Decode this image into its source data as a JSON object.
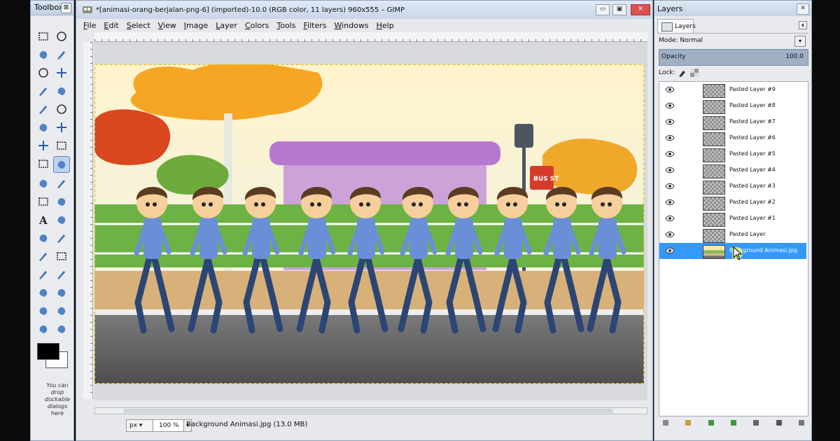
{
  "toolbox": {
    "title": "Toolbox",
    "close_glyph": "⊠",
    "tools": [
      "rect-select-icon",
      "ellipse-select-icon",
      "lasso-icon",
      "magic-wand-icon",
      "select-by-color-icon",
      "scissors-icon",
      "foreground-select-icon",
      "paths-icon",
      "color-picker-icon",
      "zoom-icon",
      "measure-icon",
      "move-icon",
      "align-icon",
      "crop-icon",
      "rotate-icon",
      "scale-icon",
      "shear-icon",
      "perspective-icon",
      "flip-icon",
      "cage-icon",
      "text-icon",
      "smudge-hand-icon",
      "bucket-fill-icon",
      "pencil-icon",
      "paintbrush-icon",
      "eraser-icon",
      "airbrush-icon",
      "ink-icon",
      "clone-icon",
      "heal-icon",
      "perspective-clone-icon",
      "blur-icon",
      "smudge-icon",
      "dodge-burn-icon"
    ],
    "drop_text": "You can drop dockable dialogs here",
    "fg_color": "#000000",
    "bg_color": "#ffffff"
  },
  "image_window": {
    "title": "*[animasi-orang-berjalan-png-6] (imported)-10.0 (RGB color, 11 layers) 960x555 – GIMP",
    "menus": [
      "File",
      "Edit",
      "Select",
      "View",
      "Image",
      "Layer",
      "Colors",
      "Tools",
      "Filters",
      "Windows",
      "Help"
    ],
    "minimize": "▭",
    "maximize": "▣",
    "close": "✕",
    "unit": "px ▾",
    "zoom": "100 %",
    "zoom_arrow": "▾",
    "status": "Background Animasi.jpg (13.0 MB)"
  },
  "scene": {
    "bus_stop_sign": "BUS ST",
    "walker_count_label": "",
    "colors": {
      "sky_top": "#fff7d8",
      "grass": "#6db244",
      "sidewalk": "#d8b07a",
      "road": "#6c6c6c",
      "shelter": "#b678d0",
      "shirt": "#6a8fd6",
      "pants": "#2c4574"
    }
  },
  "layers": {
    "title": "Layers",
    "tab_label": "Layers",
    "mode_label": "Mode: Normal",
    "mode_drop": "▾",
    "opacity_label": "Opacity",
    "opacity_value": "100.0",
    "lock_label": "Lock:",
    "items": [
      {
        "name": "Pasted Layer #9",
        "selected": false
      },
      {
        "name": "Pasted Layer #8",
        "selected": false
      },
      {
        "name": "Pasted Layer #7",
        "selected": false
      },
      {
        "name": "Pasted Layer #6",
        "selected": false
      },
      {
        "name": "Pasted Layer #5",
        "selected": false
      },
      {
        "name": "Pasted Layer #4",
        "selected": false
      },
      {
        "name": "Pasted Layer #3",
        "selected": false
      },
      {
        "name": "Pasted Layer #2",
        "selected": false
      },
      {
        "name": "Pasted Layer #1",
        "selected": false
      },
      {
        "name": "Pasted Layer",
        "selected": false
      },
      {
        "name": "Background Animasi.jpg",
        "selected": true
      }
    ],
    "bottom_buttons": [
      "new-layer-icon",
      "new-layer-group-icon",
      "raise-layer-icon",
      "lower-layer-icon",
      "duplicate-layer-icon",
      "anchor-layer-icon",
      "delete-layer-icon"
    ]
  }
}
